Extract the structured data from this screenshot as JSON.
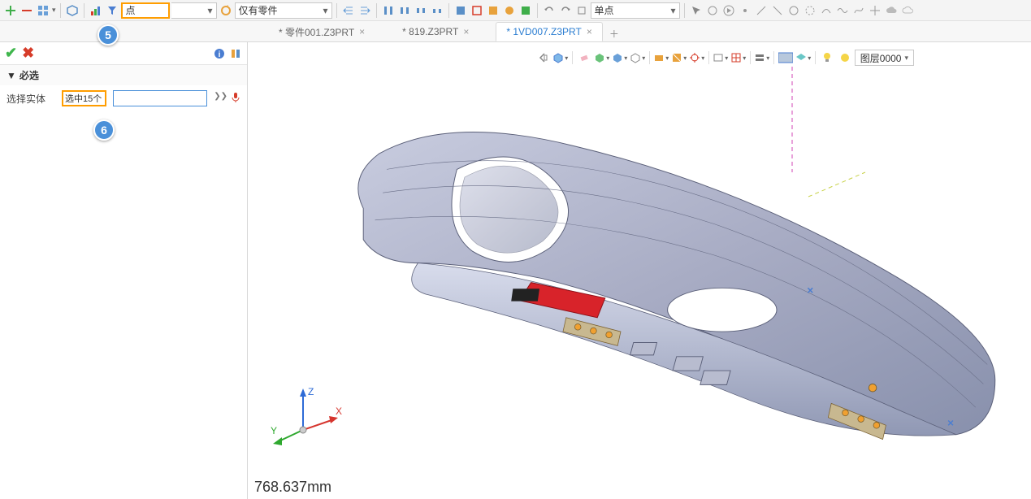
{
  "toolbar": {
    "filter_dropdown": "点",
    "scope_dropdown": "仅有零件",
    "snap_dropdown": "单点"
  },
  "tabs": [
    {
      "label": "* 零件001.Z3PRT",
      "active": false
    },
    {
      "label": "* 819.Z3PRT",
      "active": false
    },
    {
      "label": "* 1VD007.Z3PRT",
      "active": true
    }
  ],
  "panel": {
    "required_section": "必选",
    "select_entity_label": "选择实体",
    "select_entity_value": "选中15个"
  },
  "callouts": {
    "five": "5",
    "six": "6"
  },
  "layer_dropdown": "图层0000",
  "triad": {
    "x": "X",
    "y": "Y",
    "z": "Z"
  },
  "status_dimension": "768.637mm"
}
